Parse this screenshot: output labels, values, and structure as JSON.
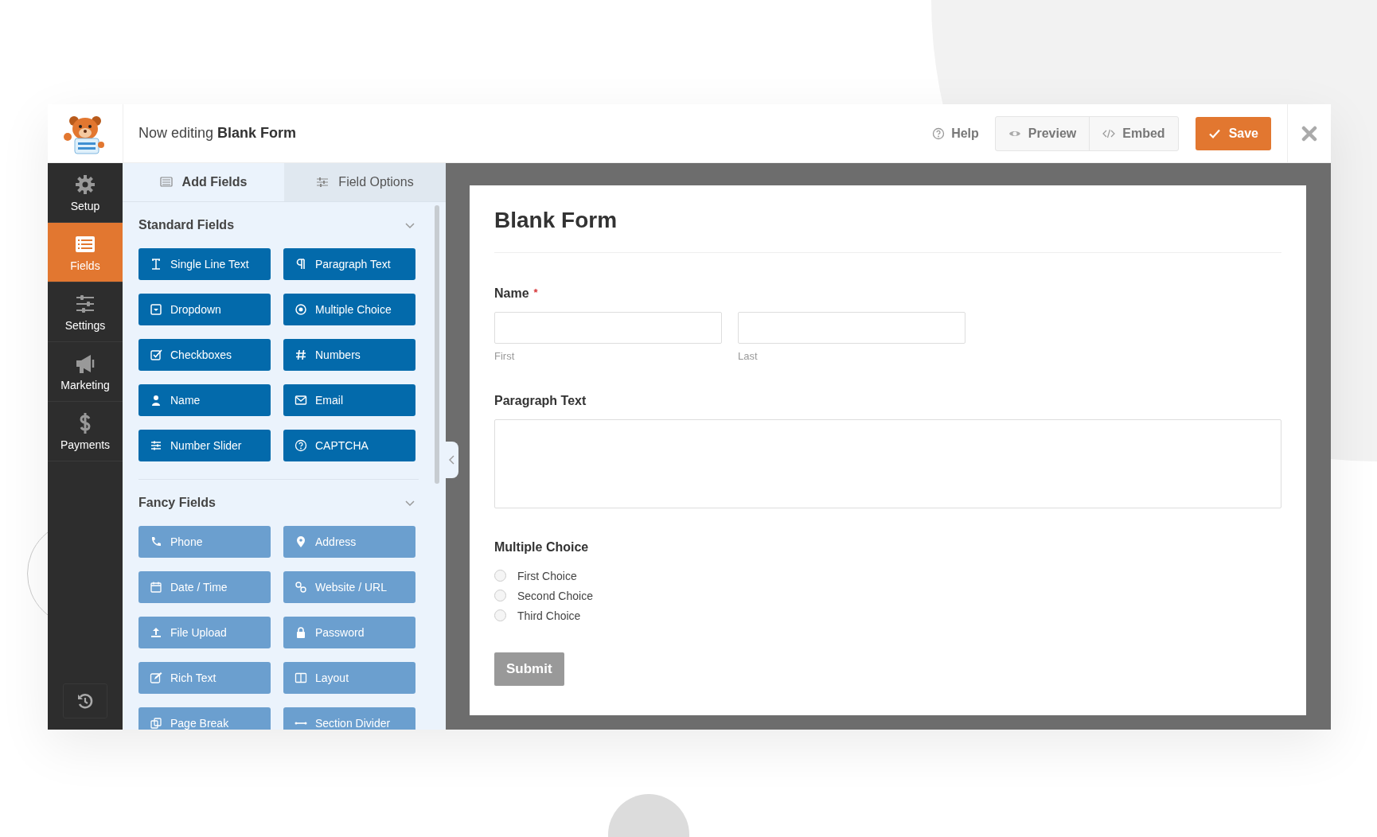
{
  "header": {
    "prefix": "Now editing",
    "form_name": "Blank Form",
    "help": "Help",
    "actions": [
      {
        "label": "Preview"
      },
      {
        "label": "Embed"
      }
    ],
    "save": "Save"
  },
  "nav": [
    {
      "label": "Setup",
      "selected": false
    },
    {
      "label": "Fields",
      "selected": true
    },
    {
      "label": "Settings",
      "selected": false
    },
    {
      "label": "Marketing",
      "selected": false
    },
    {
      "label": "Payments",
      "selected": false
    }
  ],
  "panel": {
    "tabs": [
      {
        "label": "Add Fields",
        "selected": true
      },
      {
        "label": "Field Options",
        "selected": false
      }
    ],
    "groups": [
      {
        "title": "Standard Fields",
        "expanded": true,
        "fields": [
          {
            "label": "Single Line Text",
            "disabled": false
          },
          {
            "label": "Paragraph Text",
            "disabled": false
          },
          {
            "label": "Dropdown",
            "disabled": false
          },
          {
            "label": "Multiple Choice",
            "disabled": false
          },
          {
            "label": "Checkboxes",
            "disabled": false
          },
          {
            "label": "Numbers",
            "disabled": false
          },
          {
            "label": "Name",
            "disabled": false
          },
          {
            "label": "Email",
            "disabled": false
          },
          {
            "label": "Number Slider",
            "disabled": false
          },
          {
            "label": "CAPTCHA",
            "disabled": false
          }
        ]
      },
      {
        "title": "Fancy Fields",
        "expanded": true,
        "fields": [
          {
            "label": "Phone",
            "disabled": true
          },
          {
            "label": "Address",
            "disabled": true
          },
          {
            "label": "Date / Time",
            "disabled": true
          },
          {
            "label": "Website / URL",
            "disabled": true
          },
          {
            "label": "File Upload",
            "disabled": true
          },
          {
            "label": "Password",
            "disabled": true
          },
          {
            "label": "Rich Text",
            "disabled": true
          },
          {
            "label": "Layout",
            "disabled": true
          },
          {
            "label": "Page Break",
            "disabled": true
          },
          {
            "label": "Section Divider",
            "disabled": true
          }
        ]
      }
    ]
  },
  "form": {
    "title": "Blank Form",
    "fields": [
      {
        "kind": "name",
        "label": "Name",
        "required_mark": "*",
        "sublabels": [
          "First",
          "Last"
        ]
      },
      {
        "kind": "textarea",
        "label": "Paragraph Text"
      },
      {
        "kind": "radio",
        "label": "Multiple Choice",
        "options": [
          {
            "label": "First Choice",
            "selected": false
          },
          {
            "label": "Second Choice",
            "selected": false
          },
          {
            "label": "Third Choice",
            "selected": false
          }
        ]
      }
    ],
    "submit": "Submit"
  }
}
